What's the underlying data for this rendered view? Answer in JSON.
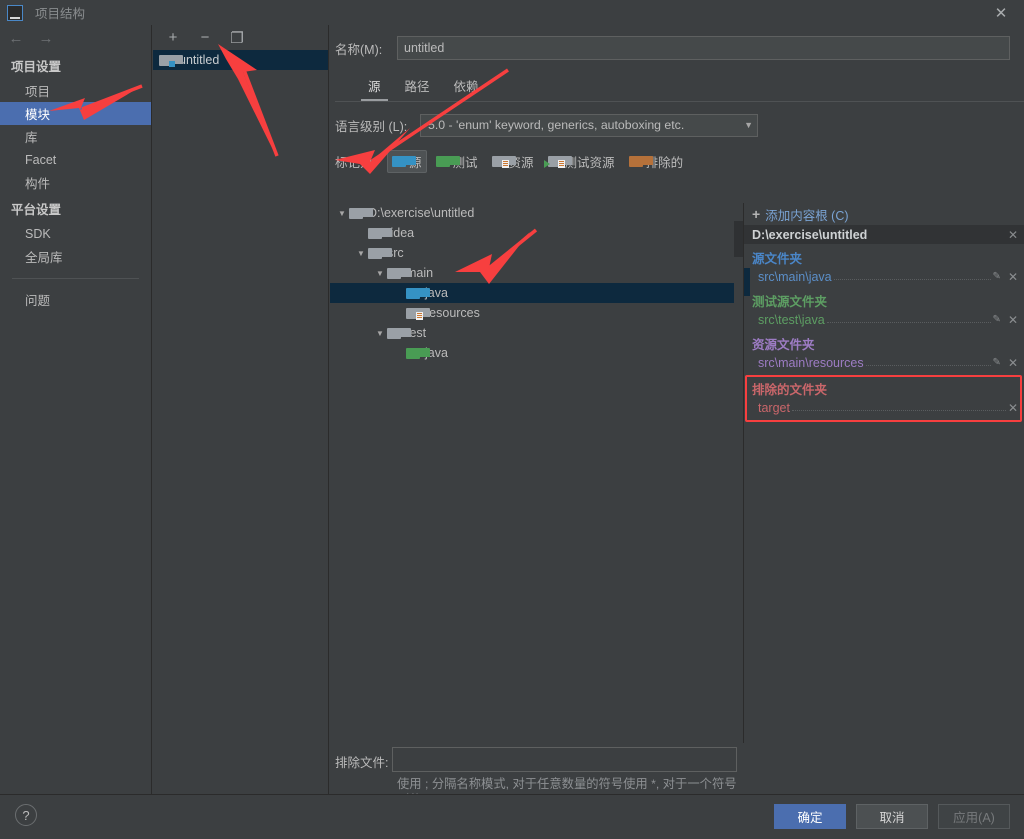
{
  "window": {
    "title": "项目结构",
    "logo_text": "IJ",
    "close_icon": "✕"
  },
  "sidebar": {
    "back_icon": "←",
    "forward_icon": "→",
    "groups": [
      {
        "title": "项目设置",
        "items": [
          {
            "label": "项目",
            "selected": false
          },
          {
            "label": "模块",
            "selected": true
          },
          {
            "label": "库",
            "selected": false
          },
          {
            "label": "Facet",
            "selected": false
          },
          {
            "label": "构件",
            "selected": false
          }
        ]
      },
      {
        "title": "平台设置",
        "items": [
          {
            "label": "SDK",
            "selected": false
          },
          {
            "label": "全局库",
            "selected": false
          }
        ]
      }
    ],
    "problems_label": "问题"
  },
  "modules": {
    "toolbar": {
      "add": "+",
      "remove": "−",
      "copy": "❐"
    },
    "items": [
      {
        "label": "untitled",
        "selected": true
      }
    ]
  },
  "main": {
    "name_label": "名称(M):",
    "name_value": "untitled",
    "tabs": [
      {
        "label": "源",
        "active": true
      },
      {
        "label": "路径",
        "active": false
      },
      {
        "label": "依赖",
        "active": false
      }
    ],
    "language_level_label": "语言级别 (L):",
    "language_level_value": "5.0 - 'enum' keyword, generics, autoboxing etc.",
    "language_level_caret": "▼",
    "mark_as_label": "标记为:",
    "mark_buttons": [
      {
        "label": "源",
        "icon": "folder-blue-icon",
        "pressed": true
      },
      {
        "label": "测试",
        "icon": "folder-green-icon",
        "pressed": false
      },
      {
        "label": "资源",
        "icon": "folder-resources-icon",
        "pressed": false
      },
      {
        "label": "测试资源",
        "icon": "folder-test-resources-icon",
        "pressed": false
      },
      {
        "label": "排除的",
        "icon": "folder-orange-icon",
        "pressed": false
      }
    ],
    "exclude_files_label": "排除文件:",
    "exclude_files_value": "",
    "exclude_files_hint": "使用 ; 分隔名称模式, 对于任意数量的符号使用 *, 对于一个符号则使用 ?。"
  },
  "tree": {
    "nodes": [
      {
        "label": "D:\\exercise\\untitled",
        "depth": 0,
        "twisty": "▼",
        "icon": "folder-gray-icon",
        "selected": false
      },
      {
        "label": ".idea",
        "depth": 1,
        "twisty": "",
        "icon": "folder-gray-icon",
        "selected": false
      },
      {
        "label": "src",
        "depth": 1,
        "twisty": "▼",
        "icon": "folder-gray-icon",
        "selected": false
      },
      {
        "label": "main",
        "depth": 2,
        "twisty": "▼",
        "icon": "folder-gray-icon",
        "selected": false
      },
      {
        "label": "java",
        "depth": 3,
        "twisty": "",
        "icon": "folder-blue-icon",
        "selected": true
      },
      {
        "label": "resources",
        "depth": 3,
        "twisty": "",
        "icon": "folder-resources-icon",
        "selected": false
      },
      {
        "label": "test",
        "depth": 2,
        "twisty": "▼",
        "icon": "folder-gray-icon",
        "selected": false
      },
      {
        "label": "java",
        "depth": 3,
        "twisty": "",
        "icon": "folder-green-icon",
        "selected": false
      }
    ]
  },
  "content_roots": {
    "add_label": "添加内容根 (C)",
    "add_icon": "+",
    "root_path": "D:\\exercise\\untitled",
    "root_close_icon": "✕",
    "sections": [
      {
        "category": "源文件夹",
        "path": "src\\main\\java",
        "kind": "source",
        "has_pencil": true,
        "highlighted": false
      },
      {
        "category": "测试源文件夹",
        "path": "src\\test\\java",
        "kind": "test",
        "has_pencil": true,
        "highlighted": false
      },
      {
        "category": "资源文件夹",
        "path": "src\\main\\resources",
        "kind": "resource",
        "has_pencil": true,
        "highlighted": false
      },
      {
        "category": "排除的文件夹",
        "path": "target",
        "kind": "excluded",
        "has_pencil": false,
        "highlighted": true
      }
    ],
    "pencil_icon": "✎",
    "remove_icon": "✕"
  },
  "footer": {
    "help_icon": "?",
    "ok_label": "确定",
    "cancel_label": "取消",
    "apply_label": "应用(A)"
  },
  "colors": {
    "background": "#3c3f41",
    "selection_blue": "#4b6eaf",
    "tree_selection": "#0d293e",
    "source_blue": "#4a86c8",
    "test_green": "#5d9e63",
    "resource_purple": "#9d7cc4",
    "excluded_red": "#c9666a",
    "annotation_red": "#f73f3f"
  }
}
